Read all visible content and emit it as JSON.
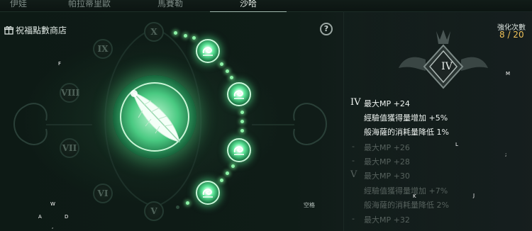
{
  "tabs": [
    {
      "label": "伊娃"
    },
    {
      "label": "帕拉蒂里歐"
    },
    {
      "label": "馬賽勒"
    },
    {
      "label": "沙哈"
    }
  ],
  "shop": {
    "label": "祝福點數商店"
  },
  "help_icon": "question-circle-icon",
  "rune_ring": {
    "left_runes": [
      "IX",
      "VIII",
      "VII",
      "VI"
    ],
    "top_rune": "X",
    "bottom_rune": "V",
    "center": "feather-emblem",
    "active_nodes": 4
  },
  "enhance": {
    "label": "強化次數",
    "value": "8 / 20"
  },
  "emblem": {
    "rank": "IV"
  },
  "stat_tiers": [
    {
      "tier": "IV",
      "active": true,
      "lines": [
        "最大MP +24",
        "經驗值獲得量增加 +5%",
        "般海薩的消耗量降低 1%"
      ]
    },
    {
      "tier": "-",
      "active": false,
      "lines": [
        "最大MP +26"
      ]
    },
    {
      "tier": "-",
      "active": false,
      "lines": [
        "最大MP +28"
      ]
    },
    {
      "tier": "V",
      "active": false,
      "lines": [
        "最大MP +30",
        "經驗值獲得量增加 +7%",
        "般海薩的消耗量降低 2%"
      ]
    },
    {
      "tier": "-",
      "active": false,
      "lines": [
        "最大MP +32"
      ]
    }
  ],
  "keys": {
    "F": "F",
    "M": "M",
    "L": "L",
    "semicolon": ";",
    "K": "K",
    "J": "J",
    "W": "W",
    "A": "A",
    "D": "D",
    "comma": ","
  },
  "footer": {
    "text": "空格"
  },
  "colors": {
    "accent_gold": "#f0c25a",
    "glow_green": "#5ee89a"
  }
}
